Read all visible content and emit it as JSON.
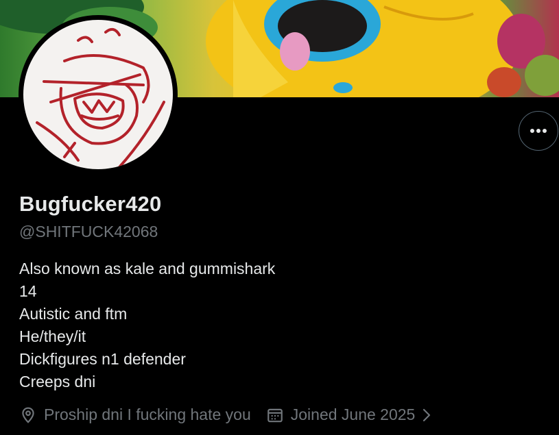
{
  "profile": {
    "display_name": "Bugfucker420",
    "handle": "@SHITFUCK42068",
    "bio_lines": [
      "Also known as kale and gummishark",
      "14",
      "Autistic and ftm",
      "He/they/it",
      "Dickfigures n1 defender",
      "Creeps dni"
    ],
    "location": "Proship dni I fucking hate you",
    "joined": "Joined June 2025"
  },
  "icons": {
    "more": "more-horizontal-icon",
    "location": "location-pin-icon",
    "calendar": "calendar-icon",
    "chevron": "chevron-right-icon"
  },
  "colors": {
    "background": "#000000",
    "primary_text": "#e7e9ea",
    "secondary_text": "#71767b",
    "border": "#536471",
    "avatar_drawing": "#b3222a"
  }
}
